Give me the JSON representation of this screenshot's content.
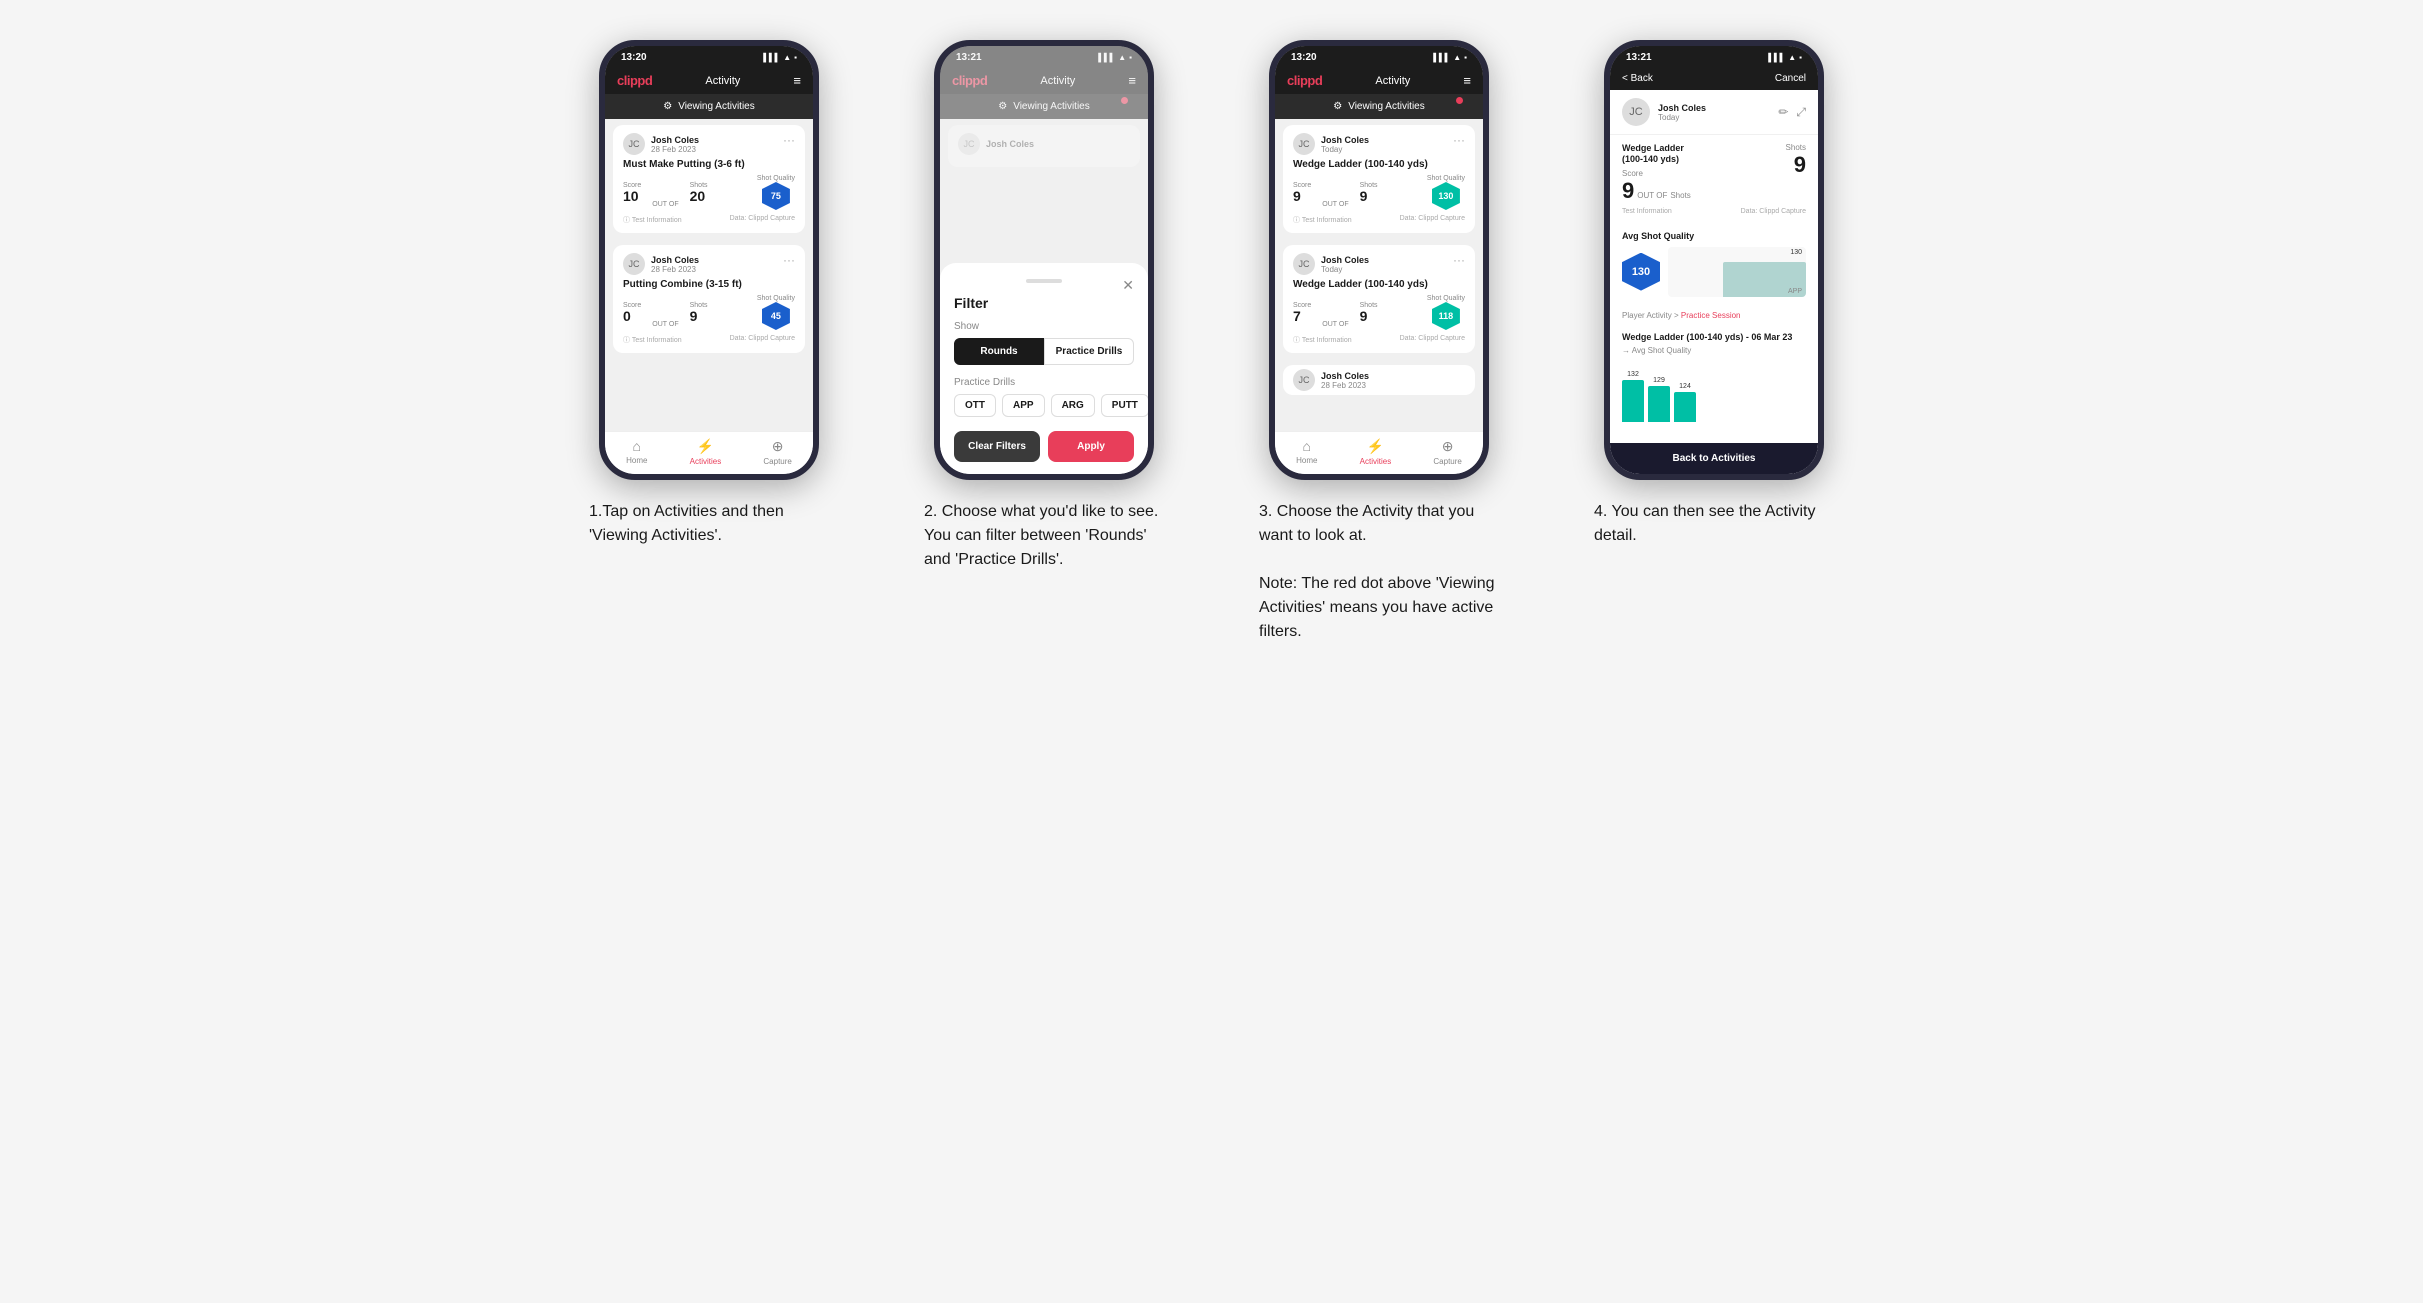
{
  "phones": [
    {
      "id": "phone1",
      "status_time": "13:20",
      "header": {
        "logo": "clippd",
        "title": "Activity",
        "has_menu": true
      },
      "viewing_bar": "Viewing Activities",
      "has_red_dot": false,
      "cards": [
        {
          "user_name": "Josh Coles",
          "user_date": "28 Feb 2023",
          "drill_name": "Must Make Putting (3-6 ft)",
          "score_label": "Score",
          "shots_label": "Shots",
          "shot_quality_label": "Shot Quality",
          "score": "10",
          "shots": "20",
          "shot_quality": "75",
          "hexagon_color": "blue"
        },
        {
          "user_name": "Josh Coles",
          "user_date": "28 Feb 2023",
          "drill_name": "Putting Combine (3-15 ft)",
          "score_label": "Score",
          "shots_label": "Shots",
          "shot_quality_label": "Shot Quality",
          "score": "0",
          "shots": "9",
          "shot_quality": "45",
          "hexagon_color": "blue"
        }
      ],
      "bottom_nav": [
        {
          "label": "Home",
          "icon": "⌂",
          "active": false
        },
        {
          "label": "Activities",
          "icon": "⚡",
          "active": true
        },
        {
          "label": "Capture",
          "icon": "⊕",
          "active": false
        }
      ]
    },
    {
      "id": "phone2",
      "status_time": "13:21",
      "header": {
        "logo": "clippd",
        "title": "Activity",
        "has_menu": true
      },
      "viewing_bar": "Viewing Activities",
      "has_red_dot": true,
      "filter": {
        "title": "Filter",
        "show_label": "Show",
        "toggle_buttons": [
          "Rounds",
          "Practice Drills"
        ],
        "active_toggle": "Rounds",
        "practice_drills_label": "Practice Drills",
        "drill_types": [
          "OTT",
          "APP",
          "ARG",
          "PUTT"
        ],
        "clear_label": "Clear Filters",
        "apply_label": "Apply"
      }
    },
    {
      "id": "phone3",
      "status_time": "13:20",
      "header": {
        "logo": "clippd",
        "title": "Activity",
        "has_menu": true
      },
      "viewing_bar": "Viewing Activities",
      "has_red_dot": true,
      "cards": [
        {
          "user_name": "Josh Coles",
          "user_date": "Today",
          "drill_name": "Wedge Ladder (100-140 yds)",
          "score_label": "Score",
          "shots_label": "Shots",
          "shot_quality_label": "Shot Quality",
          "score": "9",
          "shots": "9",
          "shot_quality": "130",
          "hexagon_color": "teal"
        },
        {
          "user_name": "Josh Coles",
          "user_date": "Today",
          "drill_name": "Wedge Ladder (100-140 yds)",
          "score_label": "Score",
          "shots_label": "Shots",
          "shot_quality_label": "Shot Quality",
          "score": "7",
          "shots": "9",
          "shot_quality": "118",
          "hexagon_color": "teal"
        },
        {
          "user_name": "Josh Coles",
          "user_date": "28 Feb 2023",
          "partial": true
        }
      ],
      "bottom_nav": [
        {
          "label": "Home",
          "icon": "⌂",
          "active": false
        },
        {
          "label": "Activities",
          "icon": "⚡",
          "active": true
        },
        {
          "label": "Capture",
          "icon": "⊕",
          "active": false
        }
      ]
    },
    {
      "id": "phone4",
      "status_time": "13:21",
      "back_label": "< Back",
      "cancel_label": "Cancel",
      "user_name": "Josh Coles",
      "user_date": "Today",
      "drill_name_header": "Wedge Ladder\n(100-140 yds)",
      "score_section": {
        "score_label": "Score",
        "shots_label": "Shots",
        "score": "9",
        "shots": "9",
        "out_of": "OUT OF",
        "test_info": "Test Information",
        "data_source": "Data: Clippd Capture"
      },
      "avg_section": {
        "title": "Avg Shot Quality",
        "value": "130",
        "chart_value": "130"
      },
      "player_activity": "Player Activity > Practice Session",
      "session_title": "Wedge Ladder (100-140 yds) - 06 Mar 23",
      "session_subtitle": "→ Avg Shot Quality",
      "chart_bars": [
        {
          "value": "132",
          "label": ""
        },
        {
          "value": "129",
          "label": ""
        },
        {
          "value": "124",
          "label": ""
        }
      ],
      "back_to_activities": "Back to Activities"
    }
  ],
  "captions": [
    "1.Tap on Activities and then 'Viewing Activities'.",
    "2. Choose what you'd like to see. You can filter between 'Rounds' and 'Practice Drills'.",
    "3. Choose the Activity that you want to look at.\n\nNote: The red dot above 'Viewing Activities' means you have active filters.",
    "4. You can then see the Activity detail."
  ]
}
